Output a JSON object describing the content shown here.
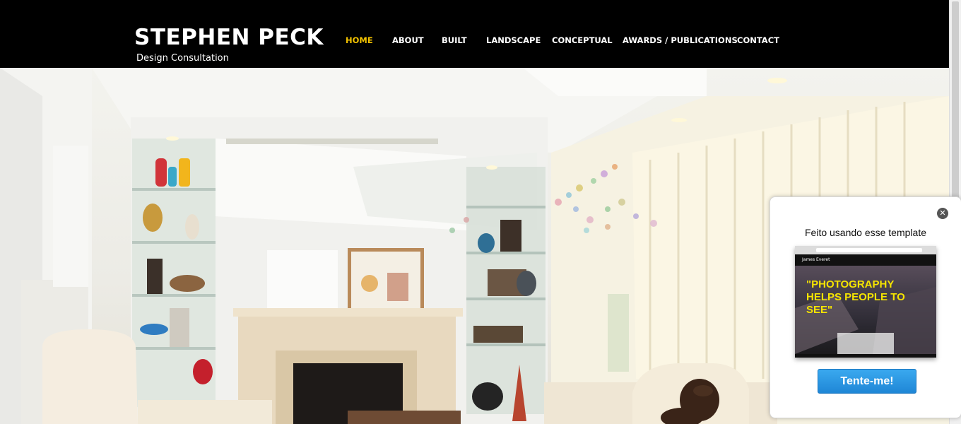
{
  "site": {
    "brand": "STEPHEN PECK",
    "tagline": "Design Consultation"
  },
  "nav": {
    "items": [
      {
        "label": "HOME",
        "active": true
      },
      {
        "label": "ABOUT",
        "active": false
      },
      {
        "label": "BUILT",
        "active": false
      },
      {
        "label": "LANDSCAPE",
        "active": false
      },
      {
        "label": "CONCEPTUAL",
        "active": false
      },
      {
        "label": "AWARDS / PUBLICATIONS",
        "active": false
      },
      {
        "label": "CONTACT",
        "active": false
      }
    ],
    "active_color": "#f2c200"
  },
  "hero": {
    "subject": "interior living room with fireplace, glass shelves, sheer curtains and a brown dog on a sofa"
  },
  "popup": {
    "title": "Feito usando esse template",
    "close_icon": "close-icon",
    "preview": {
      "site_name": "James Everet",
      "quote": "\"PHOTOGRAPHY HELPS PEOPLE TO SEE\""
    },
    "button_label": "Tente-me!"
  },
  "colors": {
    "header_bg": "#000000",
    "button_blue": "#2b97e4"
  }
}
